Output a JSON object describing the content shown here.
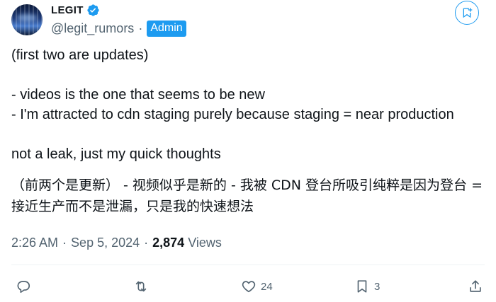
{
  "author": {
    "display_name": "LEGIT",
    "handle": "@legit_rumors",
    "separator": "·",
    "badge": "Admin",
    "verified_icon": "verified-badge-icon"
  },
  "post": {
    "lines": [
      "(first two are updates)",
      "",
      "- videos is the one that seems to be new",
      "- I'm attracted to cdn staging purely because staging = near production",
      "",
      "not a leak, just my quick thoughts"
    ],
    "translation": "（前两个是更新） - 视频似乎是新的 - 我被 CDN 登台所吸引纯粹是因为登台 = 接近生产而不是泄漏，只是我的快速想法"
  },
  "meta": {
    "time": "2:26 AM",
    "separator": "·",
    "date": "Sep 5, 2024",
    "separator2": "·",
    "views": "2,874",
    "views_label": "Views"
  },
  "actions": {
    "reply_count": "",
    "retweet_count": "",
    "like_count": "24",
    "bookmark_count": "3"
  },
  "colors": {
    "accent": "#1d9bf0",
    "text": "#0f1419",
    "muted": "#536471"
  }
}
